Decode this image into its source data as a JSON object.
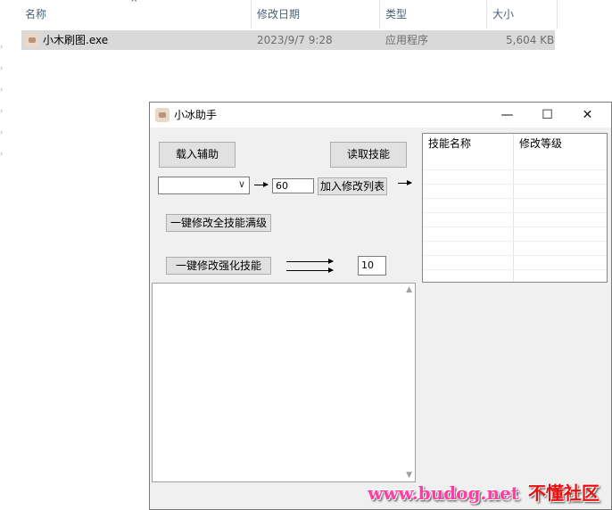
{
  "explorer": {
    "columns": {
      "name": "名称",
      "modified": "修改日期",
      "type": "类型",
      "size": "大小"
    },
    "file": {
      "name": "小木刷图.exe",
      "modified": "2023/9/7 9:28",
      "type": "应用程序",
      "size": "5,604 KB"
    }
  },
  "window": {
    "title": "小冰助手",
    "controls": {
      "minimize": "—",
      "maximize": "☐",
      "close": "✕"
    },
    "buttons": {
      "load_helper": "载入辅助",
      "read_skills": "读取技能",
      "add_to_list": "加入修改列表",
      "max_all_skills": "一键修改全技能满级",
      "modify_enhance": "一键修改强化技能"
    },
    "inputs": {
      "level_value": "60",
      "enhance_value": "10",
      "skill_select": ""
    },
    "table": {
      "headers": [
        "技能名称",
        "修改等级"
      ]
    }
  },
  "watermark": {
    "url": "www.budog.net",
    "name": "不懂社区"
  }
}
